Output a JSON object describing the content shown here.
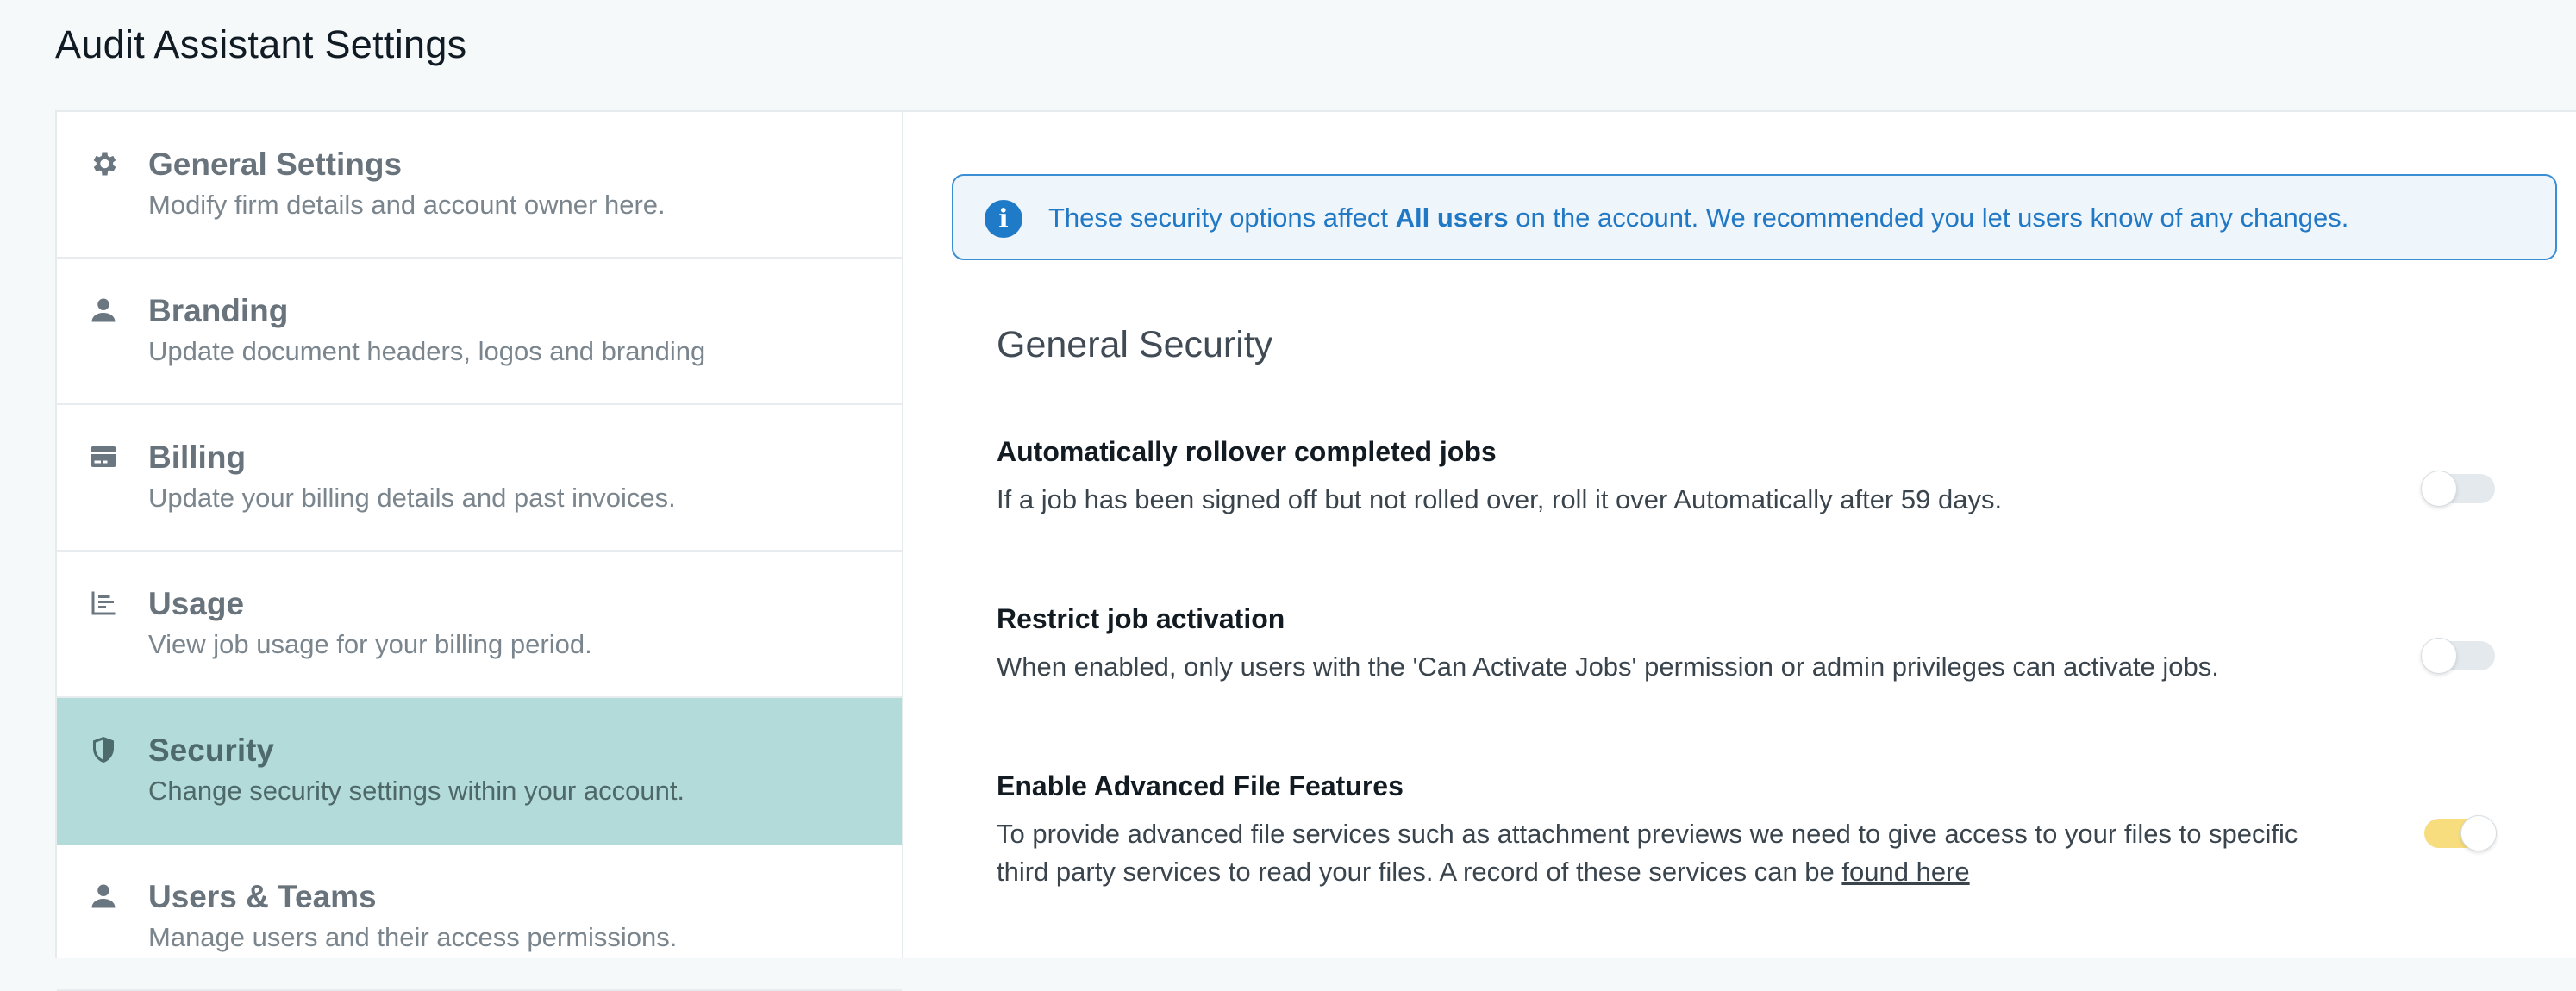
{
  "page": {
    "title": "Audit Assistant Settings"
  },
  "sidebar": {
    "items": [
      {
        "label": "General Settings",
        "description": "Modify firm details and account owner here.",
        "icon": "gear-icon",
        "active": false
      },
      {
        "label": "Branding",
        "description": "Update document headers, logos and branding",
        "icon": "user-icon",
        "active": false
      },
      {
        "label": "Billing",
        "description": "Update your billing details and past invoices.",
        "icon": "credit-card-icon",
        "active": false
      },
      {
        "label": "Usage",
        "description": "View job usage for your billing period.",
        "icon": "bar-chart-icon",
        "active": false
      },
      {
        "label": "Security",
        "description": "Change security settings within your account.",
        "icon": "shield-icon",
        "active": true
      },
      {
        "label": "Users & Teams",
        "description": "Manage users and their access permissions.",
        "icon": "user-icon",
        "active": false
      }
    ]
  },
  "banner": {
    "icon": "info-icon",
    "text_before": "These security options affect ",
    "text_bold": "All users",
    "text_after": " on the account. We recommended you let users know of any changes."
  },
  "section": {
    "title": "General Security"
  },
  "settings": [
    {
      "title": "Automatically rollover completed jobs",
      "description": "If a job has been signed off but not rolled over, roll it over Automatically after 59 days.",
      "enabled": false
    },
    {
      "title": "Restrict job activation",
      "description": "When enabled, only users with the 'Can Activate Jobs' permission or admin privileges can activate jobs.",
      "enabled": false
    },
    {
      "title": "Enable Advanced File Features",
      "description": "To provide advanced file services such as attachment previews we need to give access to your files to specific third party services to read your files. A record of these services can be ",
      "link_text": "found here",
      "enabled": true
    }
  ],
  "colors": {
    "active_nav_bg": "#b2dbd9",
    "banner_accent": "#2178c4",
    "toggle_on": "#f7dd7d",
    "toggle_off": "#e3e9ed"
  }
}
